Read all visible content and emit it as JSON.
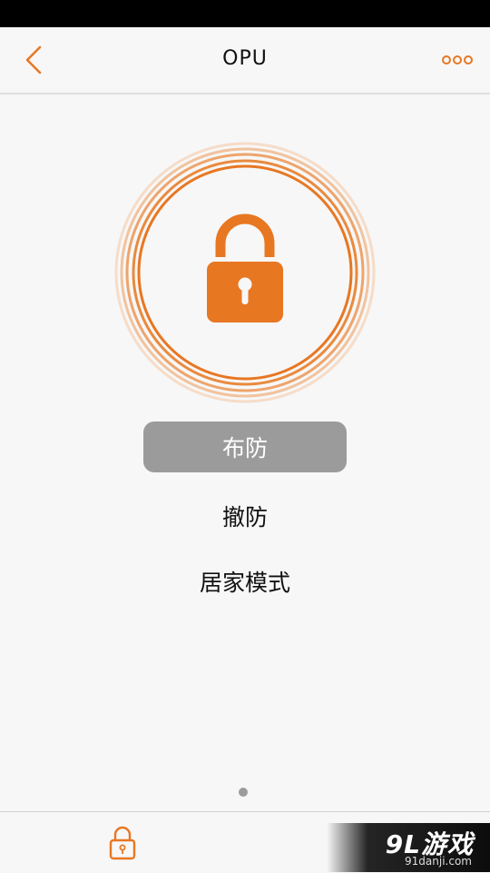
{
  "header": {
    "title": "OPU",
    "back_icon": "chevron-left-icon",
    "more_icon": "more-dots-icon"
  },
  "main": {
    "lock_icon": "padlock-icon",
    "modes": [
      {
        "label": "布防",
        "active": true
      },
      {
        "label": "撤防",
        "active": false
      },
      {
        "label": "居家模式",
        "active": false
      }
    ]
  },
  "pager": {
    "page_count": 1,
    "current_page": 1
  },
  "tabbar": {
    "lock_tab_icon": "padlock-icon"
  },
  "watermark": {
    "logo": "9L游戏",
    "url": "91danji.com"
  },
  "colors": {
    "accent": "#e87722",
    "active_button": "#9b9b9b",
    "background": "#f7f7f7"
  }
}
